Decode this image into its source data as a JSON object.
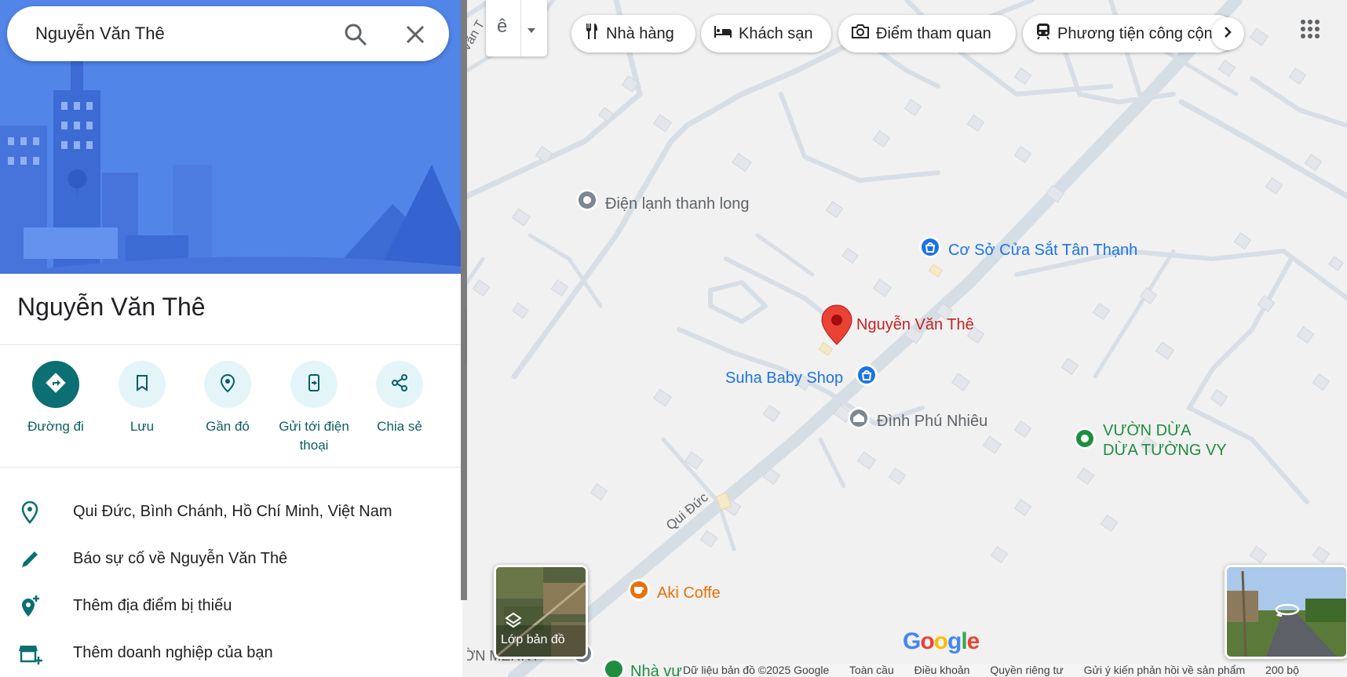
{
  "search": {
    "query": "Nguyễn Văn Thê"
  },
  "place": {
    "title": "Nguyễn Văn Thê"
  },
  "actions": [
    {
      "label": "Đường đi",
      "icon": "directions-icon"
    },
    {
      "label": "Lưu",
      "icon": "bookmark-icon"
    },
    {
      "label": "Gần đó",
      "icon": "nearby-icon"
    },
    {
      "label": "Gửi tới điện thoại",
      "icon": "send-to-phone-icon"
    },
    {
      "label": "Chia sẻ",
      "icon": "share-icon"
    }
  ],
  "info": [
    {
      "text": "Qui Đức, Bình Chánh, Hồ Chí Minh, Việt Nam",
      "icon": "location-pin-icon"
    },
    {
      "text": "Báo sự cố về Nguyễn Văn Thê",
      "icon": "pencil-icon"
    },
    {
      "text": "Thêm địa điểm bị thiếu",
      "icon": "add-place-icon"
    },
    {
      "text": "Thêm doanh nghiệp của bạn",
      "icon": "add-business-icon"
    }
  ],
  "map": {
    "lang_button": "ê",
    "chips": [
      {
        "label": "Nhà hàng",
        "icon": "restaurant-icon"
      },
      {
        "label": "Khách sạn",
        "icon": "hotel-icon"
      },
      {
        "label": "Điểm tham quan",
        "icon": "camera-icon"
      },
      {
        "label": "Phương tiện công cộng",
        "icon": "transit-icon"
      }
    ],
    "labels": {
      "dien_lanh": "Điện lạnh thanh long",
      "co_so": "Cơ Sở Cửa Sắt Tân Thạnh",
      "selected": "Nguyễn Văn Thê",
      "suha": "Suha Baby Shop",
      "dinh": "Đình Phú Nhiêu",
      "vuon_dua_1": "VƯỜN DỪA",
      "vuon_dua_2": "DỪA TƯỜNG VY",
      "aki": "Aki Coffe",
      "qui_duc": "Qui Đức",
      "van_partial": "Văn T",
      "merry": "ỜN MERRY",
      "nha_vu": "Nhà vư"
    },
    "layers_label": "Lớp bản đồ",
    "google_logo": "Google",
    "footer": [
      "Dữ liệu bản đồ ©2025 Google",
      "Toàn cầu",
      "Điều khoản",
      "Quyền riêng tư",
      "Gửi ý kiến phản hồi về sản phẩm",
      "200 bộ"
    ]
  },
  "colors": {
    "accent": "#0b6f73",
    "selected_pin": "#ea4335",
    "shop_blue": "#1a73e8",
    "park_green": "#1e8e3e",
    "cafe_orange": "#e8710a"
  }
}
